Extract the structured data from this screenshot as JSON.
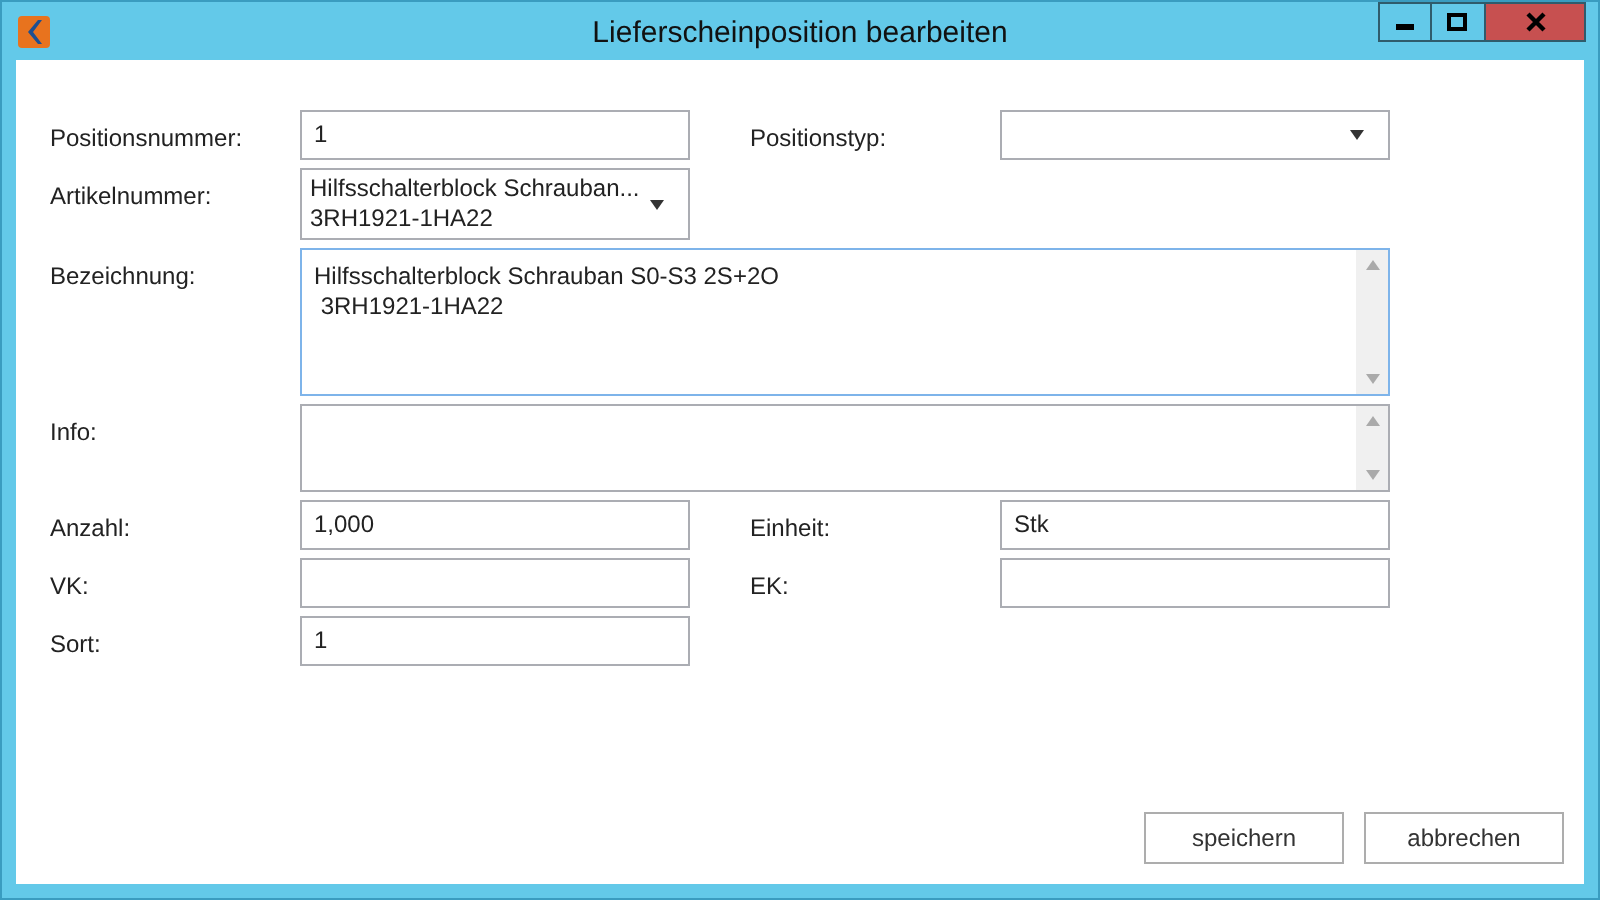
{
  "window": {
    "title": "Lieferscheinposition bearbeiten"
  },
  "rows": [
    {
      "fields": [
        {
          "label": "Positionsnummer:",
          "kind": "text",
          "value": "1",
          "focused": false
        },
        {
          "label": "Positionstyp:",
          "kind": "dropdown",
          "focused": false
        }
      ]
    },
    {
      "fields": [
        {
          "label": "Artikelnummer:",
          "kind": "dropdown",
          "value": "Hilfsschalterblock Schrauban...\n3RH1921-1HA22",
          "focused": false
        }
      ]
    },
    {
      "fields": [
        {
          "label": "Bezeichnung:",
          "kind": "textarea",
          "value": "Hilfsschalterblock Schrauban S0-S3 2S+2O\n 3RH1921-1HA22",
          "focused": true
        }
      ]
    },
    {
      "fields": [
        {
          "label": "Info:",
          "kind": "note",
          "focused": false
        }
      ]
    },
    {
      "fields": [
        {
          "label": "Anzahl:",
          "kind": "text",
          "value": "1,000",
          "focused": false
        },
        {
          "label": "Einheit:",
          "kind": "text",
          "value": "Stk",
          "focused": false
        }
      ]
    },
    {
      "fields": [
        {
          "label": "VK:",
          "kind": "text",
          "focused": false
        },
        {
          "label": "EK:",
          "kind": "text",
          "focused": false
        }
      ]
    },
    {
      "fields": [
        {
          "label": "Sort:",
          "kind": "text",
          "value": "1",
          "focused": false
        }
      ]
    }
  ],
  "buttons": [
    "speichern",
    "abbrechen"
  ]
}
